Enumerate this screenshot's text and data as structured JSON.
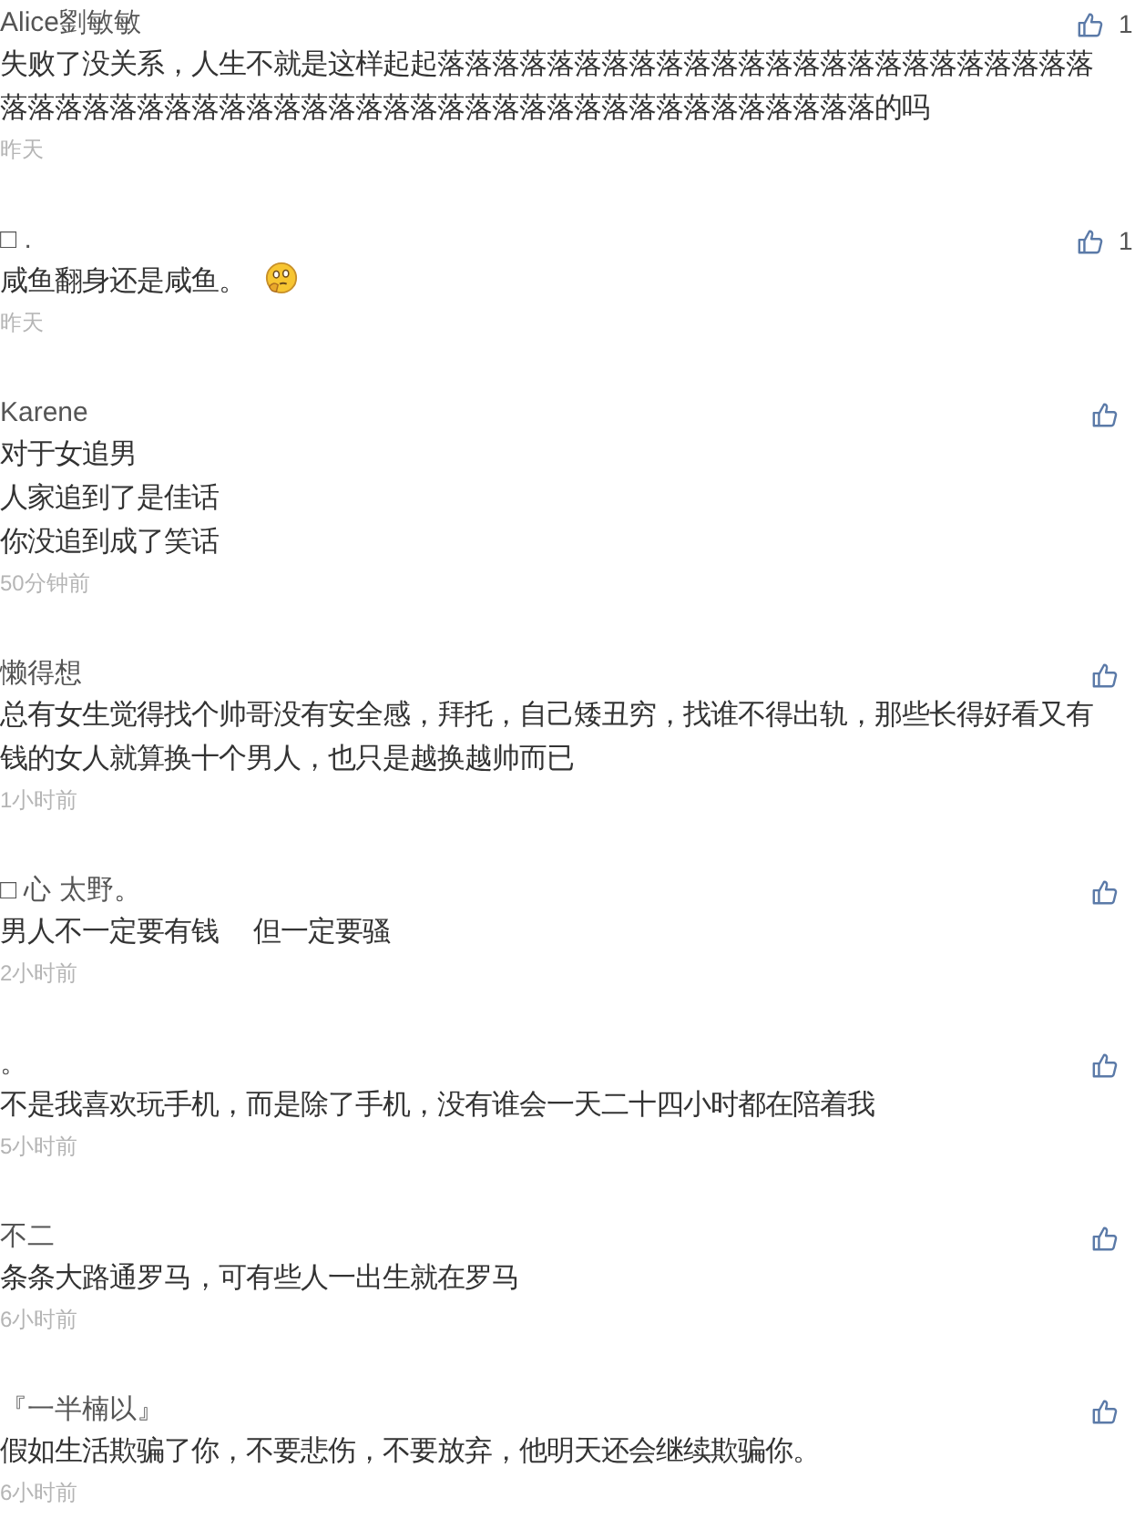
{
  "comments": [
    {
      "author": "Alice劉敏敏",
      "lines": [
        "失败了没关系，人生不就是这样起起落落落落落落落落落落落落落落落落落落落落落落落落落落落落落落落落落落落落落落落落落落落落落落落落落落落落落落落落的吗"
      ],
      "emoji": false,
      "time": "昨天",
      "likes": "1"
    },
    {
      "author": "□ .",
      "lines": [
        "咸鱼翻身还是咸鱼。"
      ],
      "emoji": true,
      "time": "昨天",
      "likes": "1"
    },
    {
      "author": "Karene",
      "lines": [
        "对于女追男",
        "人家追到了是佳话",
        "你没追到成了笑话"
      ],
      "emoji": false,
      "time": "50分钟前"
    },
    {
      "author": "懒得想",
      "lines": [
        "总有女生觉得找个帅哥没有安全感，拜托，自己矮丑穷，找谁不得出轨，那些长得好看又有钱的女人就算换十个男人，也只是越换越帅而已"
      ],
      "emoji": false,
      "time": "1小时前"
    },
    {
      "author": "□ 心 太野。",
      "lines": [
        "男人不一定要有钱　 但一定要骚"
      ],
      "emoji": false,
      "time": "2小时前"
    },
    {
      "author": "。",
      "lines": [
        "不是我喜欢玩手机，而是除了手机，没有谁会一天二十四小时都在陪着我"
      ],
      "emoji": false,
      "time": "5小时前"
    },
    {
      "author": "不二",
      "lines": [
        "条条大路通罗马，可有些人一出生就在罗马"
      ],
      "emoji": false,
      "time": "6小时前"
    },
    {
      "author": "『一半楠以』",
      "lines": [
        "假如生活欺骗了你，不要悲伤，不要放弃，他明天还会继续欺骗你。"
      ],
      "emoji": false,
      "time": "6小时前"
    }
  ]
}
